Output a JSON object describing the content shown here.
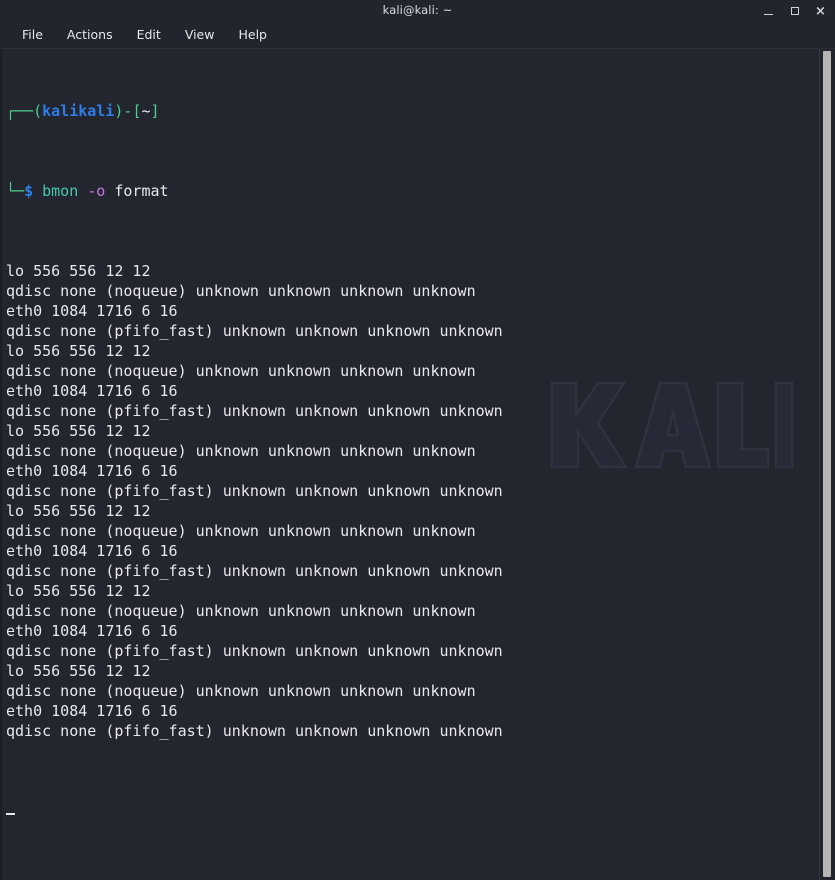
{
  "window": {
    "title": "kali@kali: ~",
    "controls": {
      "minimize": "minimize",
      "maximize": "maximize",
      "close": "×"
    }
  },
  "menubar": {
    "items": [
      {
        "label": "File"
      },
      {
        "label": "Actions"
      },
      {
        "label": "Edit"
      },
      {
        "label": "View"
      },
      {
        "label": "Help"
      }
    ]
  },
  "terminal": {
    "prompt": {
      "line1_decor": "┌──",
      "paren_open": "(",
      "user": "kali",
      "at_glyph": "㈟",
      "host": "kali",
      "paren_close": ")",
      "dash": "-",
      "bracket_open": "[",
      "path": "~",
      "bracket_close": "]",
      "line2_decor": "└─",
      "dollar": "$",
      "command": "bmon",
      "option": "-o",
      "argument": "format"
    },
    "output_lines": [
      "lo 556 556 12 12",
      "qdisc none (noqueue) unknown unknown unknown unknown",
      "eth0 1084 1716 6 16",
      "qdisc none (pfifo_fast) unknown unknown unknown unknown",
      "lo 556 556 12 12",
      "qdisc none (noqueue) unknown unknown unknown unknown",
      "eth0 1084 1716 6 16",
      "qdisc none (pfifo_fast) unknown unknown unknown unknown",
      "lo 556 556 12 12",
      "qdisc none (noqueue) unknown unknown unknown unknown",
      "eth0 1084 1716 6 16",
      "qdisc none (pfifo_fast) unknown unknown unknown unknown",
      "lo 556 556 12 12",
      "qdisc none (noqueue) unknown unknown unknown unknown",
      "eth0 1084 1716 6 16",
      "qdisc none (pfifo_fast) unknown unknown unknown unknown",
      "lo 556 556 12 12",
      "qdisc none (noqueue) unknown unknown unknown unknown",
      "eth0 1084 1716 6 16",
      "qdisc none (pfifo_fast) unknown unknown unknown unknown",
      "lo 556 556 12 12",
      "qdisc none (noqueue) unknown unknown unknown unknown",
      "eth0 1084 1716 6 16",
      "qdisc none (pfifo_fast) unknown unknown unknown unknown"
    ],
    "cursor": "_"
  },
  "watermark": {
    "text": "KALI"
  },
  "colors": {
    "background": "#23252f",
    "chrome": "#22242e",
    "foreground": "#e8e9ed",
    "prompt_green": "#4ad08c",
    "prompt_blue": "#2e7de9",
    "command_cyan": "#45c9b0",
    "option_magenta": "#c678dd",
    "scrollbar_thumb": "#b6b6b6",
    "watermark_stroke": "#2c303c"
  }
}
